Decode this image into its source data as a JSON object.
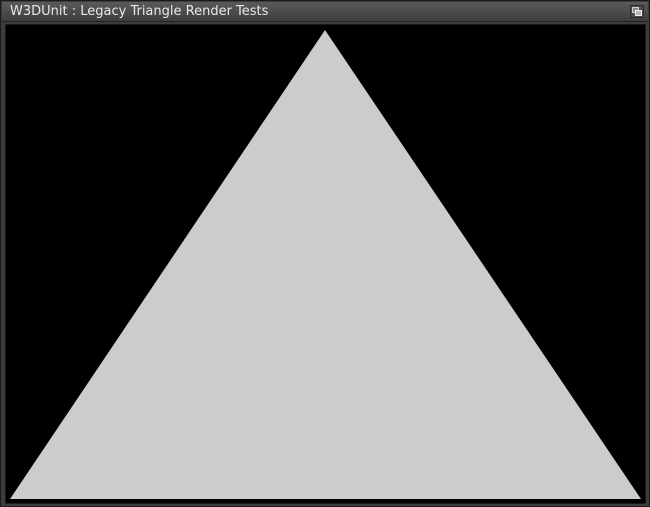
{
  "window": {
    "title": "W3DUnit : Legacy Triangle Render Tests"
  },
  "titlebar": {
    "depth_gadget_icon": "depth-arrange-icon"
  },
  "render": {
    "background_color": "#000000",
    "shape": "triangle",
    "fill_color": "#cccccc"
  }
}
